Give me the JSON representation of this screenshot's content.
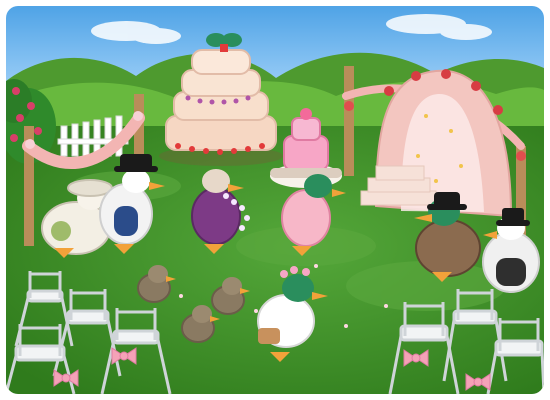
{
  "scene": {
    "colors": {
      "sky": "#4fa3e6",
      "sky_light": "#bfe2ff",
      "hills_far": "#4e9a2f",
      "hills_near": "#68b93e",
      "lawn": "#3f8f22",
      "lawn_light": "#55a83a",
      "cake_frosting": "#f6d7c3",
      "cake_trim": "#e23a3a",
      "arch_pink": "#f3c6c0",
      "chair_white": "#f2f4f5",
      "bow_pink": "#f4a2b7",
      "duck_green": "#2a8e5d",
      "duck_body": "#8b6b4f",
      "bride_dress": "#ffffff"
    },
    "icons": [
      "wedding-cake-icon",
      "bride-duck-icon",
      "groom-duck-icon",
      "duckling-icon",
      "flower-arch-icon",
      "folding-chair-icon"
    ]
  }
}
